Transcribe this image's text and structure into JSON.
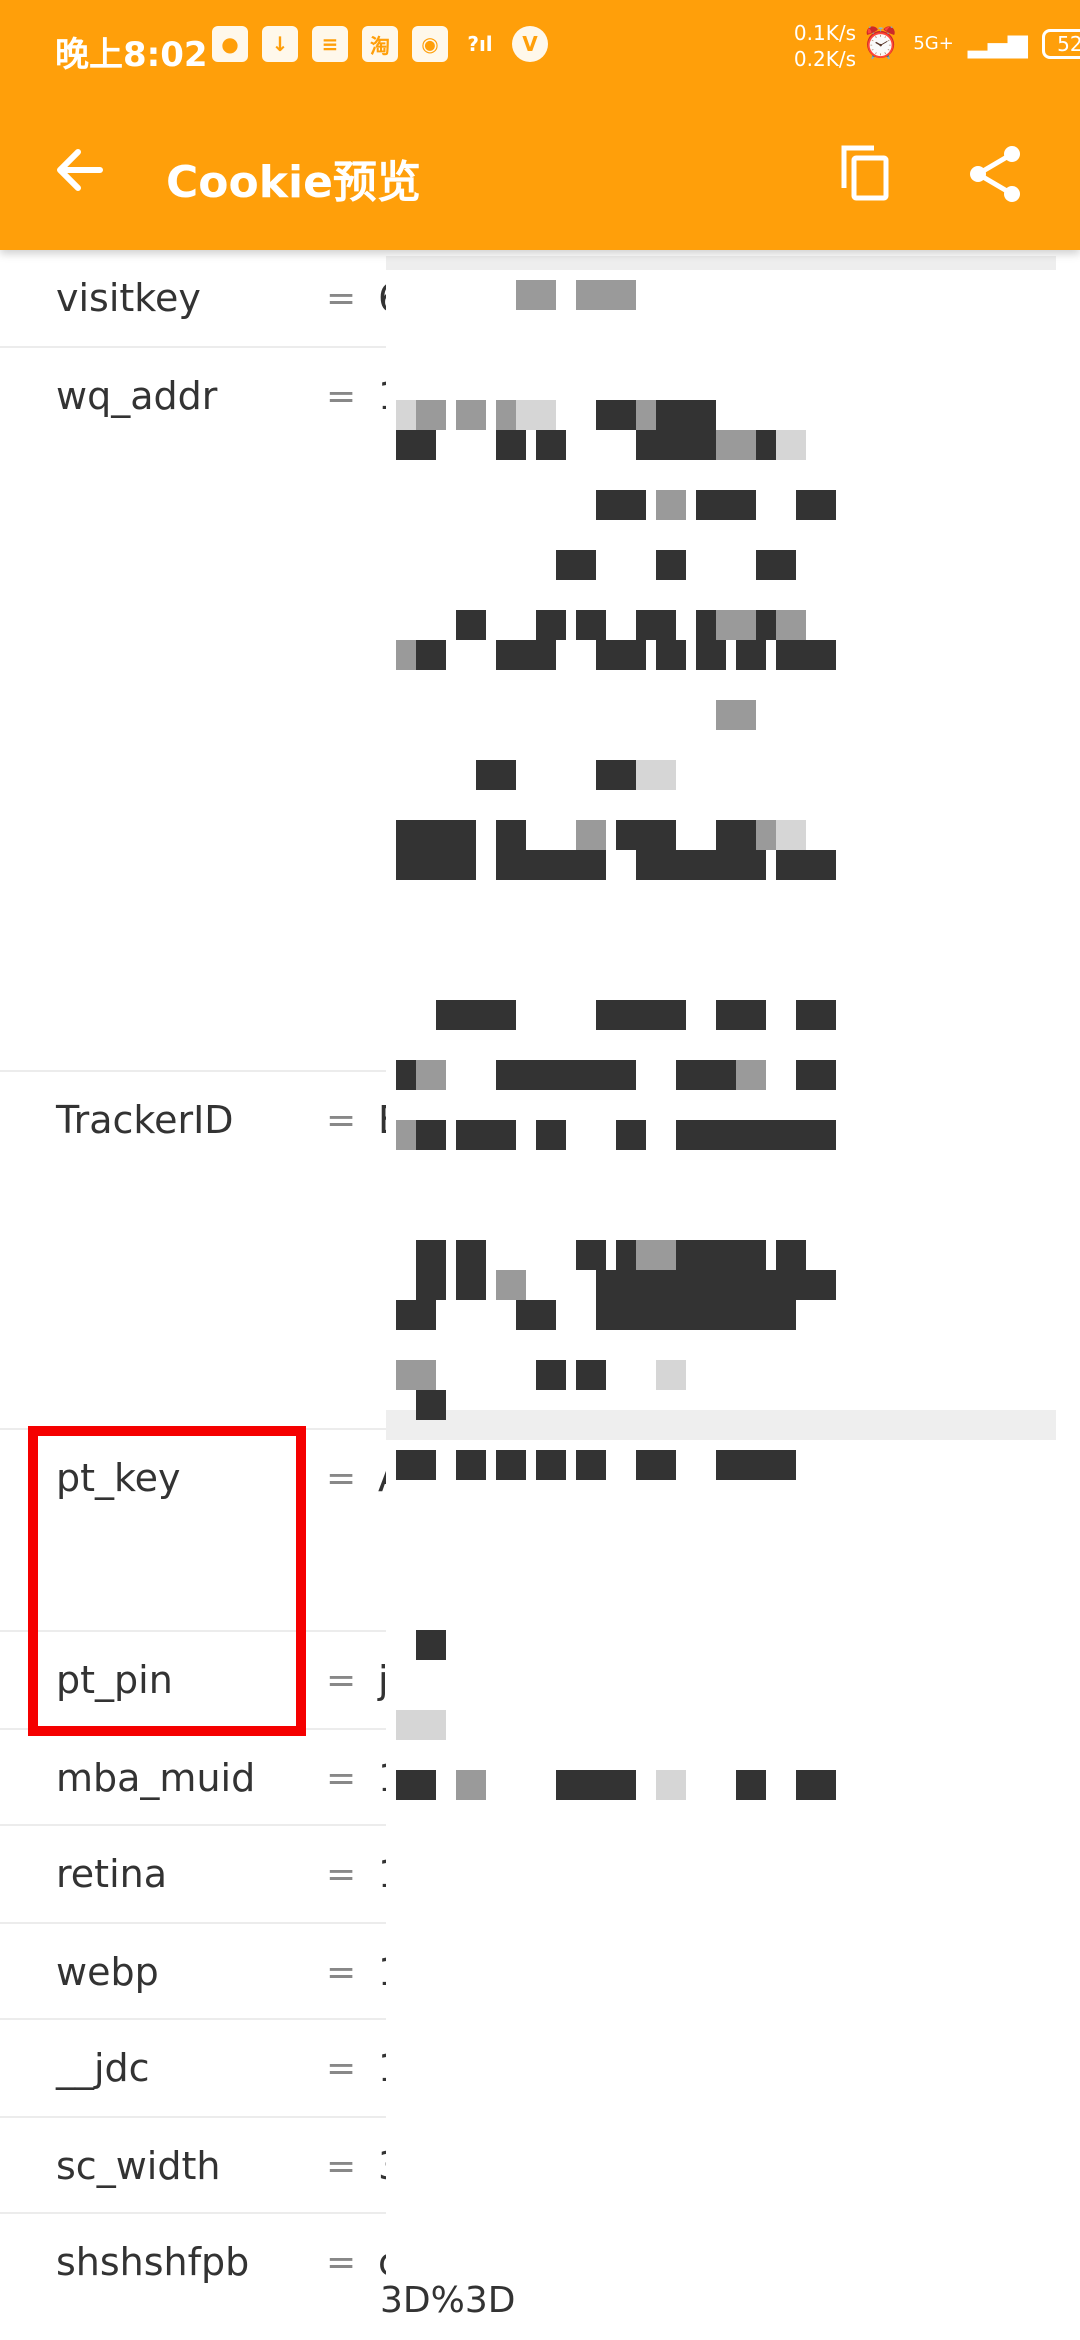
{
  "status_bar": {
    "time": "晚上8:02",
    "icons": [
      "wechat-icon",
      "download-icon",
      "storage-icon",
      "taobao-icon",
      "weibo-icon",
      "signal-icon",
      "v-icon"
    ],
    "net_up": "0.1K/s",
    "net_down": "0.2K/s",
    "network": "5G+",
    "battery": "52"
  },
  "app_bar": {
    "title": "Cookie预览",
    "color": "#FF9F0A"
  },
  "cookies": [
    {
      "key": "visitkey",
      "eq": "=",
      "value_start": "6"
    },
    {
      "key": "wq_addr",
      "eq": "=",
      "value_start": "1"
    },
    {
      "key": "TrackerID",
      "eq": "=",
      "value_start": "E"
    },
    {
      "key": "pt_key",
      "eq": "=",
      "value_start": "A"
    },
    {
      "key": "pt_pin",
      "eq": "=",
      "value_start": "j"
    },
    {
      "key": "mba_muid",
      "eq": "=",
      "value_start": "1"
    },
    {
      "key": "retina",
      "eq": "=",
      "value_start": "1"
    },
    {
      "key": "webp",
      "eq": "=",
      "value_start": "1"
    },
    {
      "key": "__jdc",
      "eq": "=",
      "value_start": "1"
    },
    {
      "key": "sc_width",
      "eq": "=",
      "value_start": "3"
    },
    {
      "key": "shshshfpb",
      "eq": "=",
      "value_start": "c"
    }
  ],
  "value_tail": "3D%3D"
}
